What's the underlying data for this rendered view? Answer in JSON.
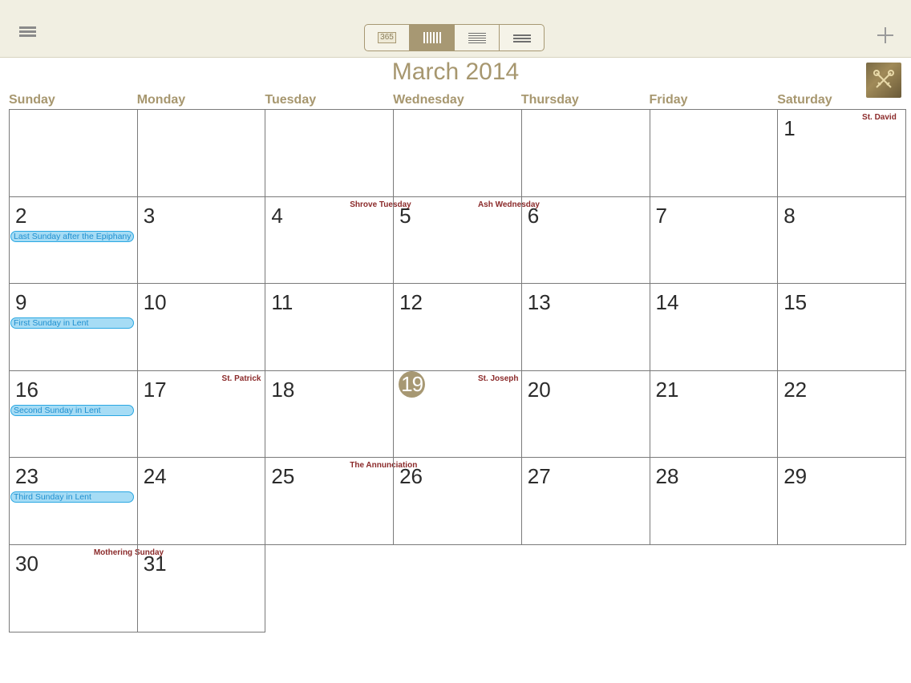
{
  "toolbar": {
    "menu_icon": "hamburger-icon",
    "add_icon": "plus-icon",
    "views": [
      {
        "name": "year",
        "label": "365",
        "active": false
      },
      {
        "name": "month",
        "icon": "grid-icon",
        "active": true
      },
      {
        "name": "week",
        "icon": "rows-icon",
        "active": false
      },
      {
        "name": "list",
        "icon": "list-icon",
        "active": false
      }
    ]
  },
  "header": {
    "month_title": "March 2014",
    "crest_icon": "crossed-keys-icon"
  },
  "weekdays": [
    "Sunday",
    "Monday",
    "Tuesday",
    "Wednesday",
    "Thursday",
    "Friday",
    "Saturday"
  ],
  "colors": {
    "accent": "#a7976f",
    "feast_text": "#8b2a2a",
    "event_fill": "#a6dcf5",
    "event_border": "#2aa7e2",
    "today_fill": "#a79873"
  },
  "today": 19,
  "days": [
    {
      "date": "1",
      "feast": "St. David"
    },
    {
      "date": "2",
      "event": "Last Sunday after the Epiphany"
    },
    {
      "date": "3"
    },
    {
      "date": "4",
      "feast": "Shrove Tuesday"
    },
    {
      "date": "5",
      "feast": "Ash Wednesday"
    },
    {
      "date": "6"
    },
    {
      "date": "7"
    },
    {
      "date": "8"
    },
    {
      "date": "9",
      "event": "First Sunday in Lent"
    },
    {
      "date": "10"
    },
    {
      "date": "11"
    },
    {
      "date": "12"
    },
    {
      "date": "13"
    },
    {
      "date": "14"
    },
    {
      "date": "15"
    },
    {
      "date": "16",
      "event": "Second Sunday in Lent"
    },
    {
      "date": "17",
      "feast": "St. Patrick"
    },
    {
      "date": "18"
    },
    {
      "date": "19",
      "feast": "St. Joseph"
    },
    {
      "date": "20"
    },
    {
      "date": "21"
    },
    {
      "date": "22"
    },
    {
      "date": "23",
      "event": "Third Sunday in Lent"
    },
    {
      "date": "24"
    },
    {
      "date": "25",
      "feast": "The Annunciation"
    },
    {
      "date": "26"
    },
    {
      "date": "27"
    },
    {
      "date": "28"
    },
    {
      "date": "29"
    },
    {
      "date": "30",
      "feast": "Mothering Sunday"
    },
    {
      "date": "31"
    }
  ]
}
